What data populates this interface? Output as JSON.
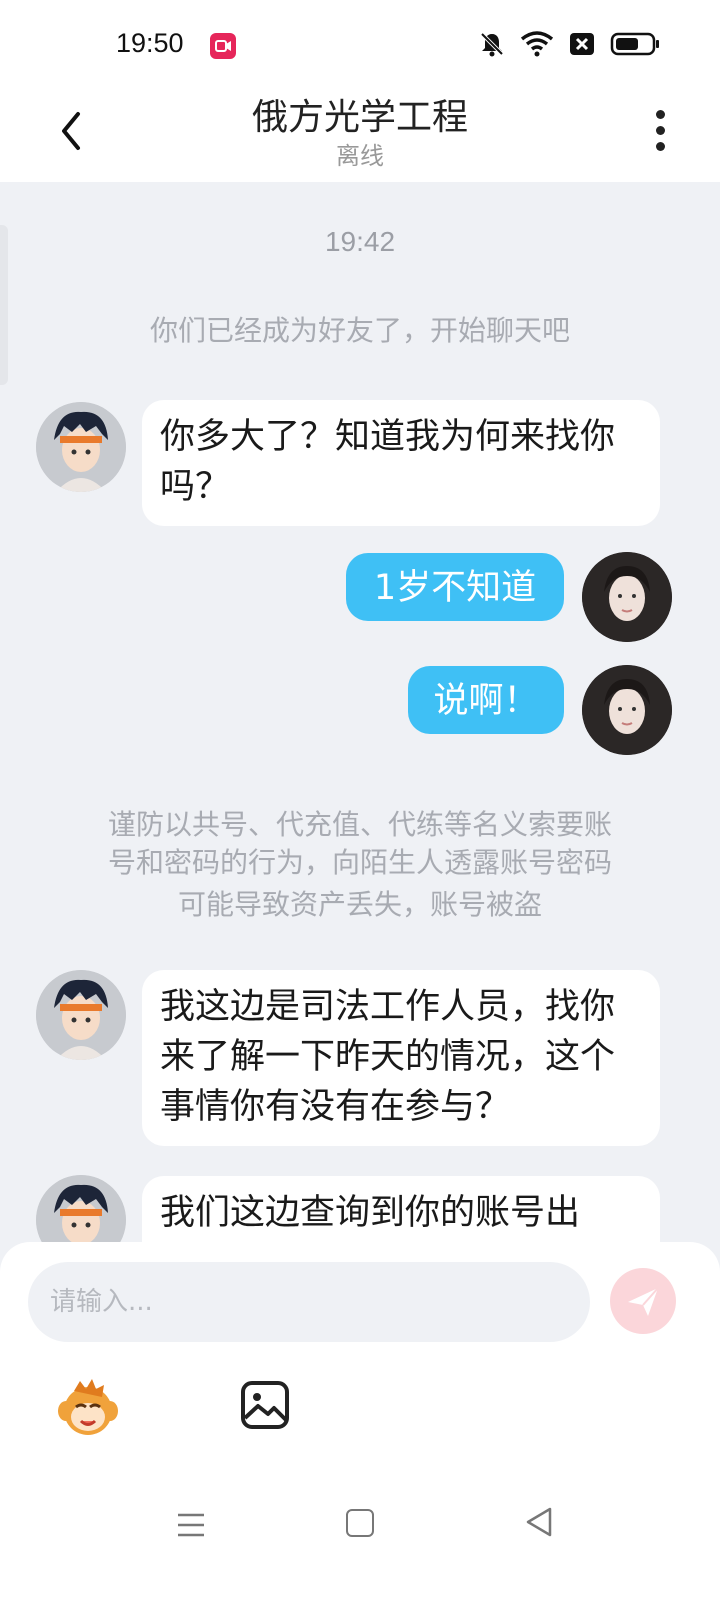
{
  "status_bar": {
    "time": "19:50",
    "icons": [
      "screen-record-icon",
      "bell-muted-icon",
      "wifi-icon",
      "sim-off-icon",
      "battery-icon"
    ]
  },
  "header": {
    "title": "俄方光学工程",
    "subtitle": "离线"
  },
  "chat": {
    "timestamp": "19:42",
    "friend_notice": "你们已经成为好友了，开始聊天吧",
    "messages": [
      {
        "side": "left",
        "text": "你多大了？知道我为何来找你吗？"
      },
      {
        "side": "right",
        "text": "1岁不知道"
      },
      {
        "side": "right",
        "text": "说啊！"
      }
    ],
    "warning_lines": [
      "谨防以共号、代充值、代练等名义索要账",
      "号和密码的行为，向陌生人透露账号密码",
      "可能导致资产丢失，账号被盗"
    ],
    "messages_after_warning": [
      {
        "side": "left",
        "text": "我这边是司法工作人员，找你来了解一下昨天的情况，这个事情你有没有在参与？"
      },
      {
        "side": "left",
        "text": "我们这边查询到你的账号出"
      }
    ]
  },
  "input": {
    "placeholder": "请输入...",
    "value": ""
  },
  "colors": {
    "accent_bubble": "#3fc0f5",
    "send_button": "#fbd6da",
    "background": "#eff1f5"
  }
}
